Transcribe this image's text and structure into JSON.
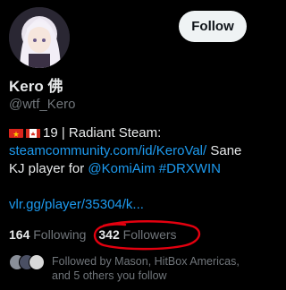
{
  "profile": {
    "display_name": "Kero 佛",
    "handle": "@wtf_Kero",
    "follow_label": "Follow"
  },
  "bio": {
    "line1_text": "19 | Radiant Steam:",
    "line2_link": "steamcommunity.com/id/KeroVal/",
    "line2_text": " Sane",
    "line3_text": "KJ player for ",
    "line3_mention": "@KomiAim",
    "line3_hashtag": "#DRXWIN",
    "line4_link": "vlr.gg/player/35304/k..."
  },
  "stats": {
    "following_count": "164",
    "following_label": "Following",
    "followers_count": "342",
    "followers_label": "Followers"
  },
  "followed_by": {
    "text": "Followed by Mason, HitBox Americas, and 5 others you follow"
  },
  "colors": {
    "background": "#000000",
    "link": "#1d9bf0",
    "muted": "#71767b",
    "annotation": "#e3000f"
  },
  "icons": [
    "vietnam-flag-icon",
    "canada-flag-icon"
  ]
}
